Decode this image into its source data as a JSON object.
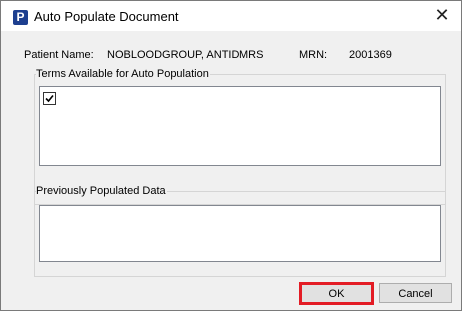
{
  "window": {
    "title": "Auto Populate Document",
    "app_icon_letter": "P",
    "close_glyph": "✕"
  },
  "patient": {
    "name_label": "Patient Name:",
    "name_value": "NOBLOODGROUP, ANTID",
    "title_value": "MRS",
    "mrn_label": "MRN:",
    "mrn_value": "2001369"
  },
  "terms_group": {
    "label": "Terms Available for Auto Population",
    "checkbox_checked": true
  },
  "previous_group": {
    "label": "Previously Populated Data"
  },
  "buttons": {
    "ok_label": "OK",
    "cancel_label": "Cancel"
  },
  "colors": {
    "highlight": "#e31c25",
    "app_icon": "#1d3f8f"
  }
}
